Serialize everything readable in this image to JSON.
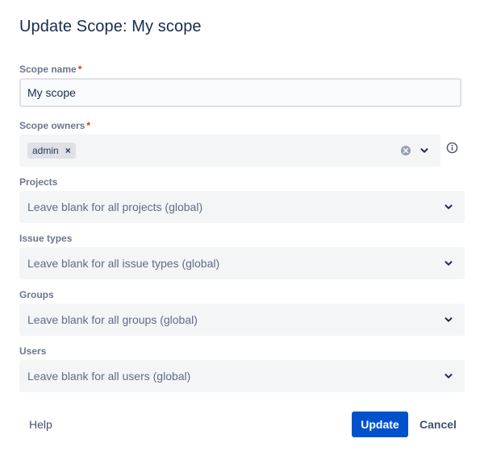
{
  "dialog": {
    "title": "Update Scope: My scope"
  },
  "scope_name": {
    "label": "Scope name",
    "required_mark": "*",
    "value": "My scope"
  },
  "scope_owners": {
    "label": "Scope owners",
    "required_mark": "*",
    "selected": [
      "admin"
    ],
    "chip_remove_glyph": "×",
    "icons": [
      "clear-icon",
      "chevron-down-icon",
      "info-icon"
    ]
  },
  "projects": {
    "label": "Projects",
    "placeholder": "Leave blank for all projects (global)"
  },
  "issue_types": {
    "label": "Issue types",
    "placeholder": "Leave blank for all issue types (global)"
  },
  "groups": {
    "label": "Groups",
    "placeholder": "Leave blank for all groups (global)"
  },
  "users": {
    "label": "Users",
    "placeholder": "Leave blank for all users (global)"
  },
  "footer": {
    "help_label": "Help",
    "update_label": "Update",
    "cancel_label": "Cancel"
  },
  "colors": {
    "primary": "#0052cc",
    "required": "#de350b",
    "text": "#172b4d",
    "select_bg": "#f4f5f7"
  }
}
